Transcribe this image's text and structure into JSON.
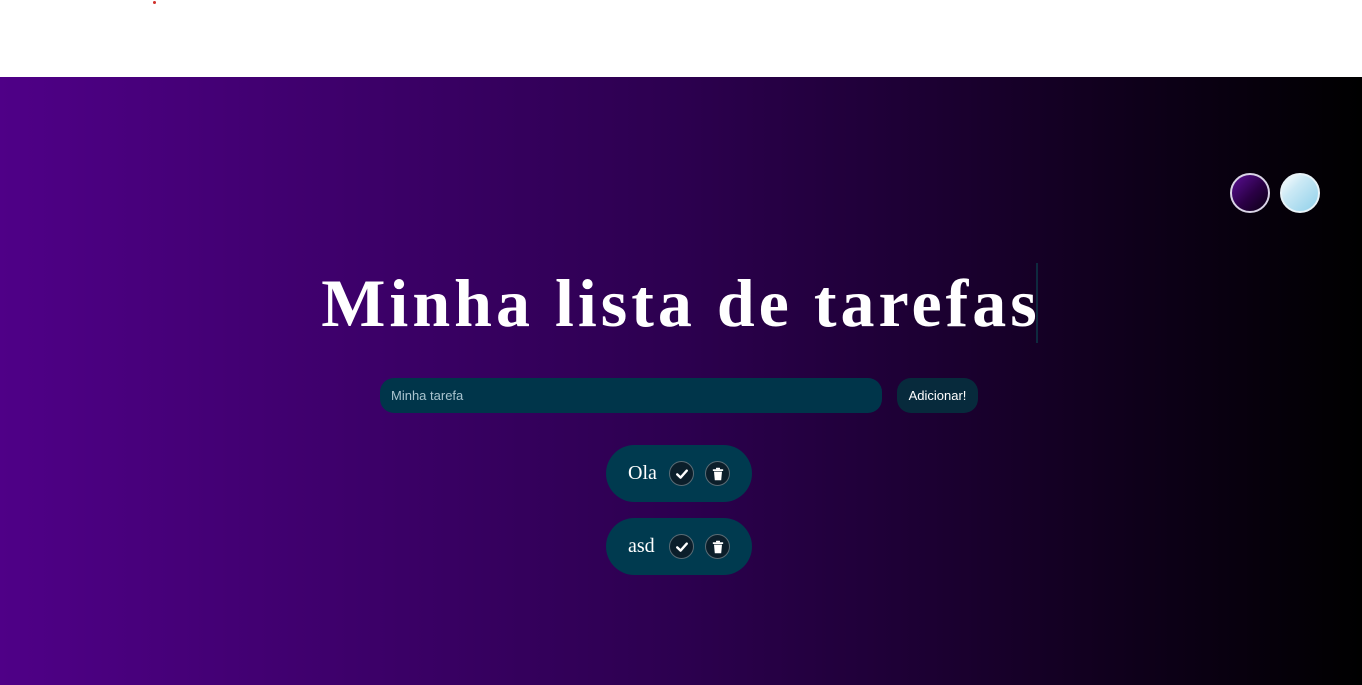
{
  "page": {
    "title": "Minha lista de tarefas"
  },
  "theme_switch": {
    "dark_color": "#4f0087",
    "light_color": "#8fd0ea"
  },
  "form": {
    "input_placeholder": "Minha tarefa",
    "add_button_label": "Adicionar!"
  },
  "tasks": [
    {
      "text": "Ola",
      "check_icon": "check-icon",
      "delete_icon": "trash-icon"
    },
    {
      "text": "asd",
      "check_icon": "check-icon",
      "delete_icon": "trash-icon"
    }
  ],
  "colors": {
    "gradient_start": "#4f0087",
    "gradient_mid": "#2c004f",
    "gradient_end": "#000000",
    "input_bg": "#00354a",
    "task_bg": "#003a4f"
  }
}
